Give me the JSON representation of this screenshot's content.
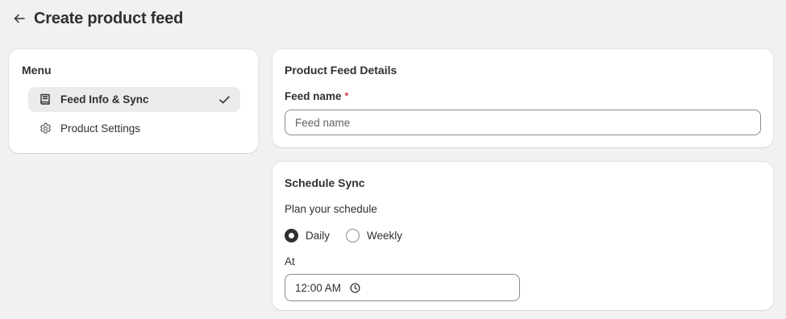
{
  "header": {
    "back_icon": "arrow-left-icon",
    "title": "Create product feed"
  },
  "menu": {
    "title": "Menu",
    "items": [
      {
        "label": "Feed Info & Sync",
        "icon": "book-icon",
        "active": true,
        "status_icon": "checkmark-icon"
      },
      {
        "label": "Product Settings",
        "icon": "gear-icon",
        "active": false
      }
    ]
  },
  "details": {
    "title": "Product Feed Details",
    "feed_name_label": "Feed name",
    "required_mark": "*",
    "feed_name_value": "",
    "feed_name_placeholder": "Feed name"
  },
  "schedule": {
    "title": "Schedule Sync",
    "description": "Plan your schedule",
    "options": [
      {
        "label": "Daily",
        "selected": true
      },
      {
        "label": "Weekly",
        "selected": false
      }
    ],
    "at_label": "At",
    "time_value": "12:00 AM",
    "time_icon": "clock-icon"
  },
  "colors": {
    "background": "#f1f1f1",
    "card": "#ffffff",
    "active_menu": "#ebebeb",
    "text": "#303030",
    "required": "#c70a24",
    "border": "#8a8a8a"
  }
}
